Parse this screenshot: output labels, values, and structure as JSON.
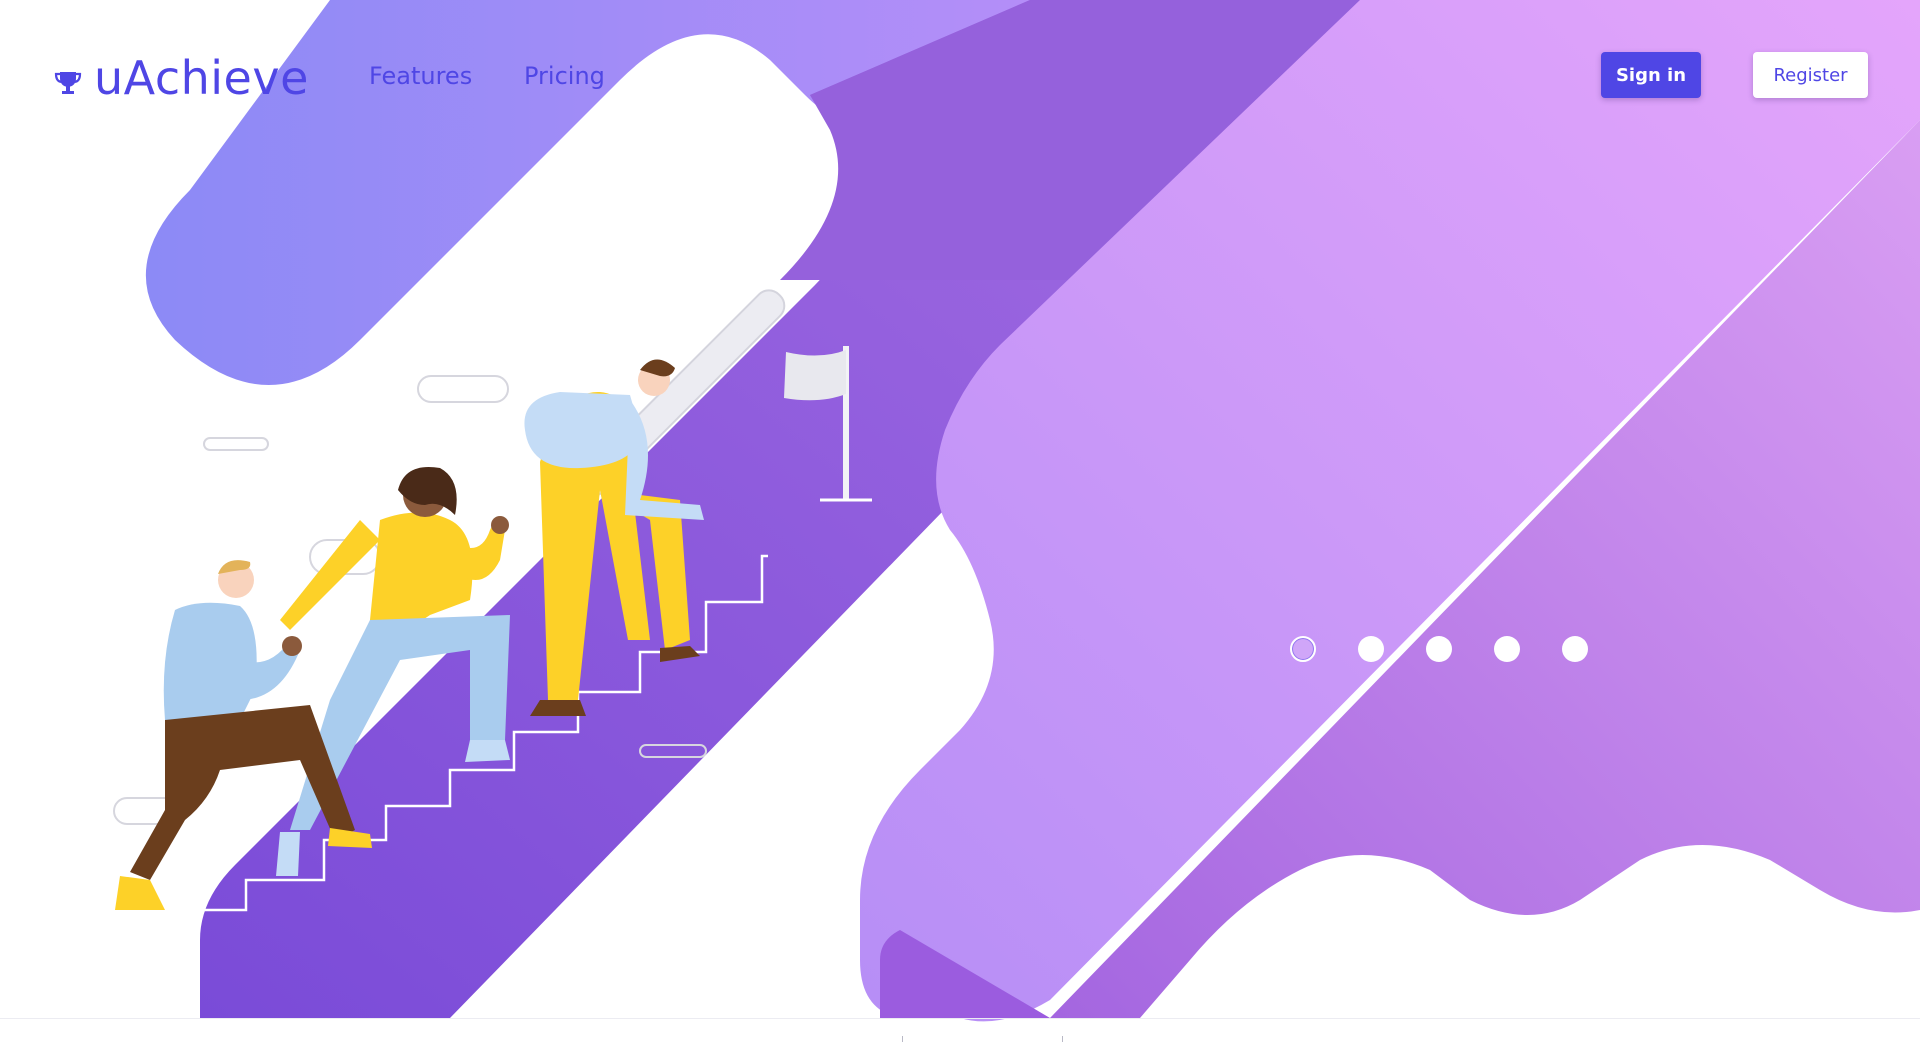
{
  "brand": {
    "name": "uAchieve",
    "icon": "trophy-icon",
    "color": "#4f46e5"
  },
  "nav": {
    "links": [
      {
        "label": "Features"
      },
      {
        "label": "Pricing"
      }
    ]
  },
  "auth": {
    "sign_in_label": "Sign in",
    "register_label": "Register"
  },
  "carousel": {
    "slide_count": 5,
    "active_index": 0
  },
  "colors": {
    "primary": "#4f46e5",
    "purple_dark": "#7c4ddb",
    "purple_mid": "#9b6fe6",
    "lavender": "#c49af5",
    "pink": "#e5a6fb",
    "indigo_light": "#8f8cf6",
    "yellow": "#fdd128",
    "light_blue": "#a9ccee"
  }
}
